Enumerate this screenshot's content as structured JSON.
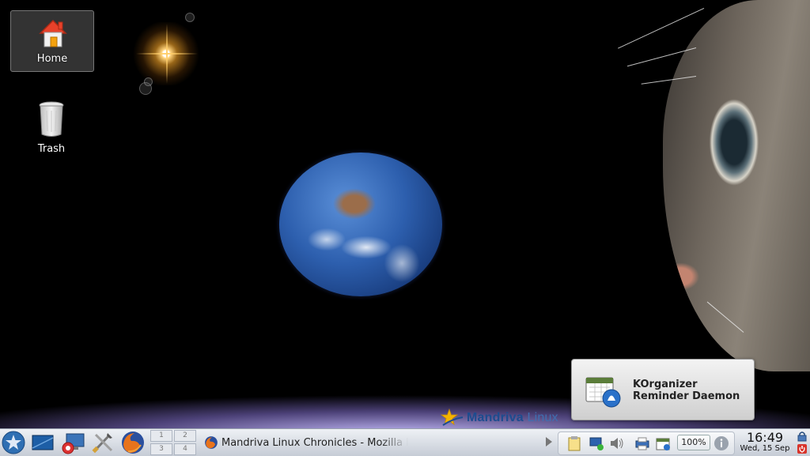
{
  "desktop": {
    "icons": [
      {
        "label": "Home",
        "icon": "home-folder-icon",
        "selected": true
      },
      {
        "label": "Trash",
        "icon": "trash-icon",
        "selected": false
      }
    ],
    "brand": {
      "name_bold": "Mandriva",
      "name_light": " Linux"
    }
  },
  "notification": {
    "line1": "KOrganizer",
    "line2": "Reminder Daemon",
    "icon": "calendar-bell-icon"
  },
  "panel": {
    "launchers": [
      "application-menu-icon",
      "show-desktop-icon",
      "system-configuration-icon",
      "tools-icon",
      "firefox-icon"
    ],
    "pager": [
      "1",
      "2",
      "3",
      "4"
    ],
    "task": {
      "title": "Mandriva Linux Chronicles - Mozilla Firefox",
      "icon": "firefox-icon"
    },
    "tray": {
      "icons": [
        "clipboard-icon",
        "network-icon",
        "volume-icon",
        "printer-icon",
        "calendar-icon",
        "info-icon"
      ],
      "battery": "100%"
    },
    "clock": {
      "time": "16:49",
      "date": "Wed, 15 Sep"
    },
    "right_icons": [
      "lock-icon",
      "logout-icon"
    ]
  }
}
